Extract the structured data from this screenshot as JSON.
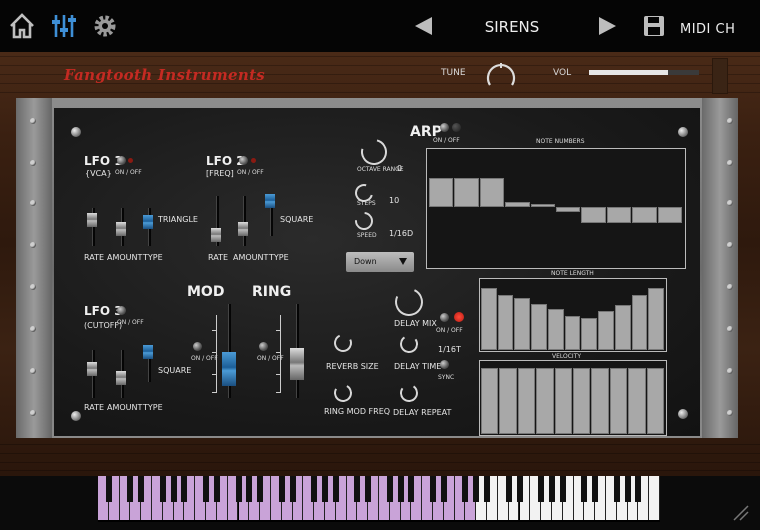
{
  "app": {
    "preset_name": "SIRENS",
    "midi_label": "MIDI CH",
    "brand": "Fangtooth Instruments",
    "icons": [
      "home-icon",
      "mixer-icon",
      "gear-icon",
      "prev-arrow-icon",
      "next-arrow-icon",
      "save-icon"
    ]
  },
  "header": {
    "tune_label": "TUNE",
    "vol_label": "VOL",
    "vol_level": 0.72
  },
  "lfo1": {
    "title": "LFO 1",
    "sub": "{VCA}",
    "onoff": "ON / OFF",
    "type_value": "TRIANGLE"
  },
  "lfo2": {
    "title": "LFO 2",
    "sub": "[FREQ]",
    "onoff": "ON / OFF",
    "type_value": "SQUARE"
  },
  "lfo3": {
    "title": "LFO 3",
    "sub": "(CUTOFF)",
    "onoff": "ON / OFF",
    "type_value": "SQUARE"
  },
  "labels": {
    "rate": "RATE",
    "amount": "AMOUNT",
    "type": "TYPE",
    "mod": "MOD",
    "ring": "RING",
    "onoff": "ON / OFF",
    "reverb_size": "REVERB SIZE",
    "ring_mod_freq": "RING MOD FREQ",
    "delay_mix": "DELAY MIX",
    "delay_time": "DELAY TIME",
    "delay_repeat": "DELAY REPEAT",
    "delay_value": "1/16T",
    "sync": "SYNC"
  },
  "arp": {
    "title": "ARP",
    "onoff": "ON / OFF",
    "octave_range_label": "OCTAVE RANGE",
    "octave_range_value": "0",
    "steps_label": "STEPS",
    "steps_value": "10",
    "speed_label": "SPEED",
    "speed_value": "1/16D",
    "direction": "Down"
  },
  "sequencer": {
    "note_numbers_title": "NOTE NUMBERS",
    "note_numbers": [
      0.55,
      0.55,
      0.55,
      0.1,
      0.05,
      -0.1,
      -0.3,
      -0.3,
      -0.3,
      -0.3
    ],
    "note_length_title": "NOTE LENGTH",
    "note_length": [
      0.88,
      0.78,
      0.74,
      0.66,
      0.58,
      0.48,
      0.46,
      0.56,
      0.64,
      0.78,
      0.88
    ],
    "velocity_title": "VELOCITY",
    "velocity": [
      0.92,
      0.92,
      0.92,
      0.92,
      0.92,
      0.92,
      0.92,
      0.92,
      0.92,
      0.92
    ]
  },
  "colors": {
    "accent_blue": "#2f7fc1",
    "brand_red": "#c42a22",
    "led_red": "#e23324",
    "key_highlight": "#c9a3d8"
  }
}
